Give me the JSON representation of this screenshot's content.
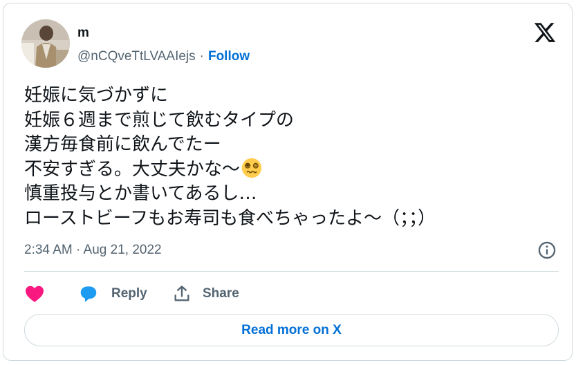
{
  "author": {
    "name": "m",
    "handle": "@nCQveTtLVAAIejs",
    "separator": "·",
    "follow_label": "Follow",
    "avatar": "avatar-photo"
  },
  "tweet": {
    "lines": [
      "妊娠に気づかずに",
      "妊娠６週まで煎じて飲むタイプの",
      "漢方毎食前に飲んでたー",
      "不安すぎる。大丈夫かな～",
      "慎重投与とか書いてあるし…",
      "ローストビーフもお寿司も食べちゃったよ～（；；）"
    ],
    "emoji": "dizzy-face-emoji",
    "timestamp": "2:34 AM · Aug 21, 2022"
  },
  "actions": {
    "like_icon": "heart-icon",
    "reply_label": "Reply",
    "share_label": "Share"
  },
  "read_more_label": "Read more on X",
  "colors": {
    "accent": "#006fd6",
    "heart": "#f91880",
    "reply_bubble": "#1d9bf0",
    "secondary_text": "#536471",
    "border": "#cfd9de"
  }
}
